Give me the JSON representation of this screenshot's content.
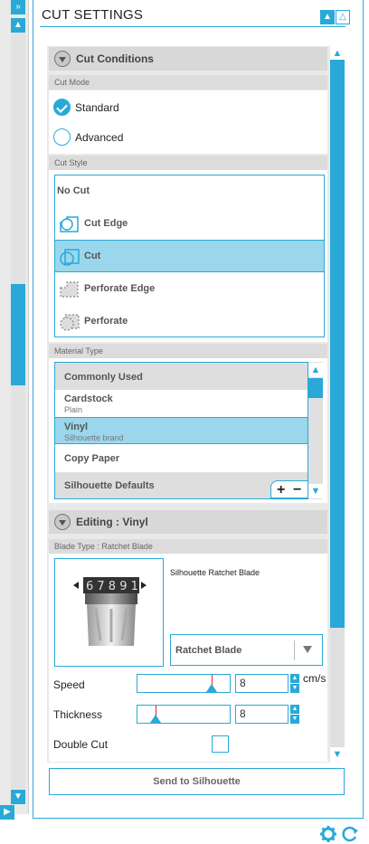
{
  "header": {
    "title": "CUT SETTINGS"
  },
  "sections": {
    "cut_conditions": "Cut Conditions",
    "editing": "Editing : Vinyl"
  },
  "cut_mode": {
    "label": "Cut Mode",
    "options": [
      {
        "label": "Standard",
        "selected": true
      },
      {
        "label": "Advanced",
        "selected": false
      }
    ]
  },
  "cut_style": {
    "label": "Cut Style",
    "options": [
      {
        "label": "No Cut"
      },
      {
        "label": "Cut Edge"
      },
      {
        "label": "Cut",
        "selected": true
      },
      {
        "label": "Perforate Edge"
      },
      {
        "label": "Perforate"
      }
    ]
  },
  "material": {
    "label": "Material Type",
    "group_header": "Commonly Used",
    "items": [
      {
        "name": "Cardstock",
        "sub": "Plain"
      },
      {
        "name": "Vinyl",
        "sub": "Silhouette brand",
        "selected": true
      },
      {
        "name": "Copy Paper",
        "sub": ""
      }
    ],
    "footer": "Silhouette Defaults",
    "add": "+",
    "remove": "−"
  },
  "blade": {
    "label": "Blade Type : Ratchet Blade",
    "name": "Silhouette Ratchet Blade",
    "select_value": "Ratchet Blade",
    "dial_digits": "6 7 8 9 1"
  },
  "speed": {
    "label": "Speed",
    "value": "8",
    "unit": "cm/s",
    "level": 0.8
  },
  "thickness": {
    "label": "Thickness",
    "value": "8",
    "level": 0.2
  },
  "double_cut": {
    "label": "Double Cut",
    "checked": false
  },
  "send_button": "Send to Silhouette",
  "icons": {
    "collapse_left": "double-chevron-icon",
    "settings": "gear-icon",
    "refresh": "refresh-icon"
  },
  "colors": {
    "accent": "#29a9d8",
    "selected_row": "#9ad7ec",
    "section_bg": "#d8d8d8"
  }
}
